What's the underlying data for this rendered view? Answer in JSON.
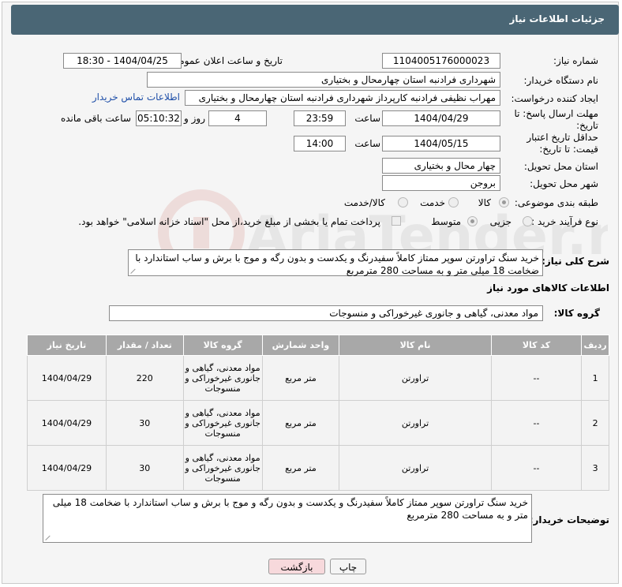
{
  "header": {
    "title": "جزئیات اطلاعات نیاز"
  },
  "form": {
    "need_number_label": "شماره نیاز:",
    "need_number": "1104005176000023",
    "announce_label": "تاریخ و ساعت اعلان عمومی:",
    "announce_value": "1404/04/25 - 18:30",
    "buyer_org_label": "نام دستگاه خریدار:",
    "buyer_org": "شهرداری فرادنبه استان چهارمحال و بختیاری",
    "creator_label": "ایجاد کننده درخواست:",
    "creator": "مهراب نظیفی فرادنبه کارپرداز شهرداری فرادنبه استان چهارمحال و بختیاری",
    "contact_link": "اطلاعات تماس خریدار",
    "reply_deadline_label": "مهلت ارسال پاسخ: تا تاریخ:",
    "reply_date": "1404/04/29",
    "time_label": "ساعت",
    "reply_time": "23:59",
    "days_value": "4",
    "days_label": "روز و",
    "remaining_time": "05:10:32",
    "remaining_label": "ساعت باقی مانده",
    "price_deadline_label": "حداقل تاریخ اعتبار قیمت: تا تاریخ:",
    "price_date": "1404/05/15",
    "price_time": "14:00",
    "province_label": "استان محل تحویل:",
    "province": "چهار محال و بختیاری",
    "city_label": "شهر محل تحویل:",
    "city": "بروجن",
    "category_label": "طبقه بندی موضوعی:",
    "category_options": [
      "کالا",
      "خدمت",
      "کالا/خدمت"
    ],
    "process_label": "نوع فرآیند خرید :",
    "process_options": [
      "جزیی",
      "متوسط"
    ],
    "payment_note": "پرداخت تمام یا بخشی از مبلغ خرید،از محل \"اسناد خزانه اسلامی\" خواهد بود."
  },
  "description": {
    "label": "شرح کلی نیاز:",
    "text": "خرید سنگ تراورتن سوپر ممتاز کاملاً  سفیدرنگ و یکدست و بدون رگه و موج با برش و ساب استاندارد با ضخامت 18 میلی متر و به مساحت 280 مترمربع"
  },
  "goods": {
    "section_title": "اطلاعات کالاهای مورد نیاز",
    "group_label": "گروه کالا:",
    "group_value": "مواد معدنی، گیاهی و جانوری غیرخوراکی و منسوجات",
    "columns": [
      "ردیف",
      "کد کالا",
      "نام کالا",
      "واحد شمارش",
      "گروه کالا",
      "تعداد / مقدار",
      "تاریخ نیاز"
    ],
    "rows": [
      {
        "row": "1",
        "code": "--",
        "name": "تراورتن",
        "unit": "متر مربع",
        "group": "مواد معدنی، گیاهی و جانوری غیرخوراکی و منسوجات",
        "qty": "220",
        "date": "1404/04/29"
      },
      {
        "row": "2",
        "code": "--",
        "name": "تراورتن",
        "unit": "متر مربع",
        "group": "مواد معدنی، گیاهی و جانوری غیرخوراکی و منسوجات",
        "qty": "30",
        "date": "1404/04/29"
      },
      {
        "row": "3",
        "code": "--",
        "name": "تراورتن",
        "unit": "متر مربع",
        "group": "مواد معدنی، گیاهی و جانوری غیرخوراکی و منسوجات",
        "qty": "30",
        "date": "1404/04/29"
      }
    ]
  },
  "buyer_notes": {
    "label": "توضیحات خریدار:",
    "text": "خرید سنگ تراورتن سوپر ممتاز کاملاً  سفیدرنگ و یکدست و بدون رگه و موج با برش و ساب استاندارد با ضخامت 18 میلی متر و به مساحت 280 مترمربع"
  },
  "buttons": {
    "print": "چاپ",
    "back": "بازگشت"
  },
  "watermark": {
    "text": "AriaTender.neT"
  },
  "colors": {
    "header": "#4a6675",
    "table_header": "#a8a8a8",
    "link": "#1f4fa8",
    "back_button": "#f7d9dc"
  }
}
